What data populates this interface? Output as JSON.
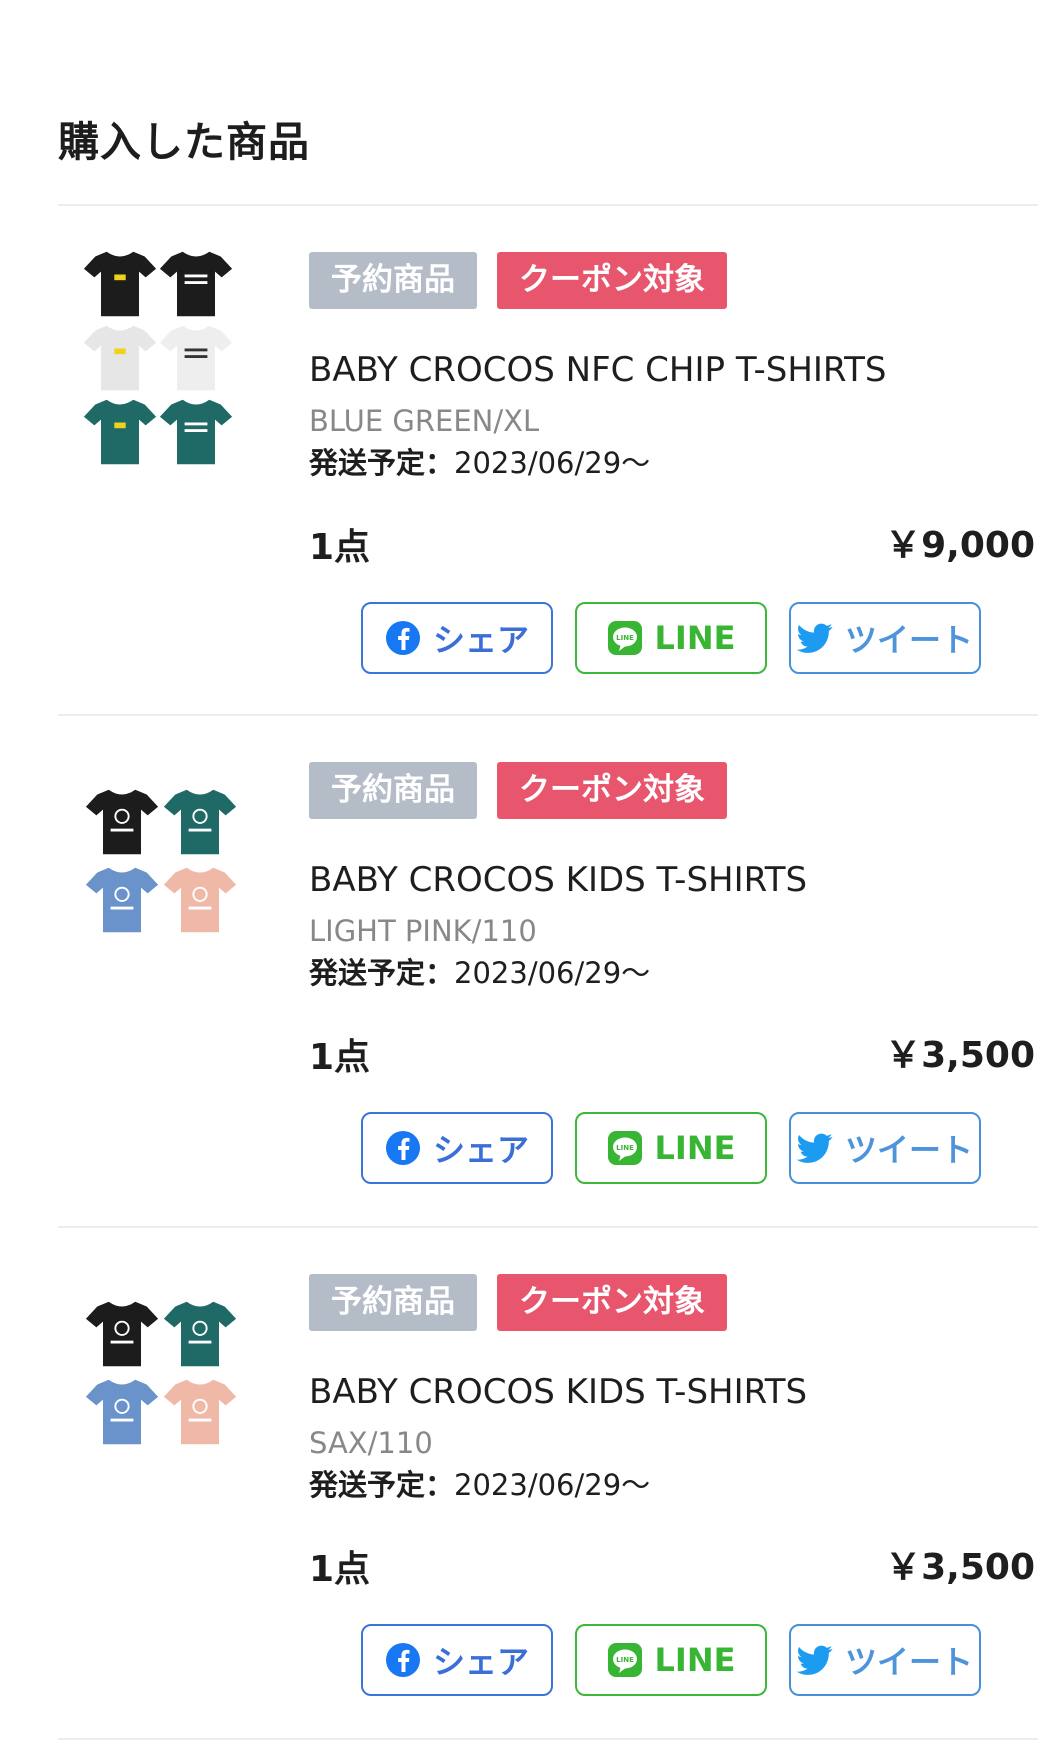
{
  "page": {
    "title": "購入した商品"
  },
  "items": [
    {
      "badges": {
        "reserve": "予約商品",
        "coupon": "クーポン対象"
      },
      "name": "BABY CROCOS NFC CHIP T-SHIRTS",
      "variant": "BLUE GREEN/XL",
      "ship_label": "発送予定：",
      "ship_date": "2023/06/29〜",
      "quantity": "1点",
      "price": "￥9,000",
      "thumb_colors": [
        "#1c1c1c",
        "#1c1c1c",
        "#e6e6e6",
        "#eeeeee",
        "#1f6a66",
        "#1f6a66"
      ],
      "share": {
        "facebook": "シェア",
        "line": "LINE",
        "twitter": "ツイート"
      }
    },
    {
      "badges": {
        "reserve": "予約商品",
        "coupon": "クーポン対象"
      },
      "name": "BABY CROCOS KIDS T-SHIRTS",
      "variant": "LIGHT PINK/110",
      "ship_label": "発送予定：",
      "ship_date": "2023/06/29〜",
      "quantity": "1点",
      "price": "￥3,500",
      "thumb_colors": [
        "#1c1c1c",
        "#1f6a66",
        "#6a93cc",
        "#f0b8a6"
      ],
      "share": {
        "facebook": "シェア",
        "line": "LINE",
        "twitter": "ツイート"
      }
    },
    {
      "badges": {
        "reserve": "予約商品",
        "coupon": "クーポン対象"
      },
      "name": "BABY CROCOS KIDS T-SHIRTS",
      "variant": "SAX/110",
      "ship_label": "発送予定：",
      "ship_date": "2023/06/29〜",
      "quantity": "1点",
      "price": "￥3,500",
      "thumb_colors": [
        "#1c1c1c",
        "#1f6a66",
        "#6a93cc",
        "#f0b8a6"
      ],
      "share": {
        "facebook": "シェア",
        "line": "LINE",
        "twitter": "ツイート"
      }
    }
  ],
  "colors": {
    "reserve_badge": "#b4bcc8",
    "coupon_badge": "#e8566e",
    "facebook": "#3b6fd6",
    "line": "#39b534",
    "twitter": "#4d94dc"
  }
}
